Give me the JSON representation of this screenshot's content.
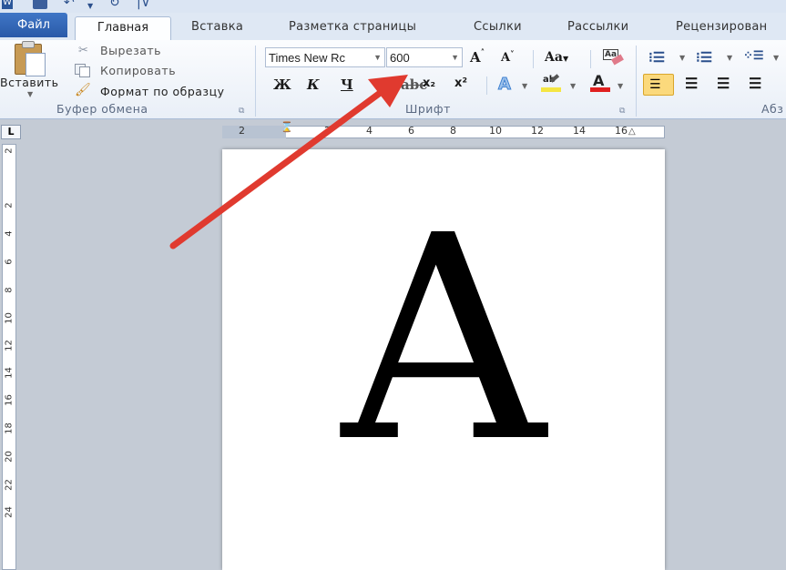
{
  "quick_access": {
    "word_icon": "word-app-icon",
    "save_icon": "save-icon",
    "undo_icon": "undo-icon",
    "redo_icon": "redo-icon",
    "customize_icon": "customize-qat-icon"
  },
  "tabs": {
    "file": "Файл",
    "home": "Главная",
    "insert": "Вставка",
    "layout": "Разметка страницы",
    "references": "Ссылки",
    "mailings": "Рассылки",
    "review": "Рецензирован"
  },
  "clipboard": {
    "paste_label": "Вставить",
    "cut_label": "Вырезать",
    "copy_label": "Копировать",
    "format_painter_label": "Формат по образцу",
    "group_label": "Буфер обмена"
  },
  "font": {
    "font_name": "Times New Rc",
    "font_size": "600",
    "bold": "Ж",
    "italic": "К",
    "underline": "Ч",
    "subscript": "x₂",
    "superscript": "x²",
    "change_case": "Aa",
    "group_label": "Шрифт"
  },
  "paragraph": {
    "group_label": "Абз"
  },
  "ruler": {
    "marks": [
      "2",
      "2",
      "4",
      "6",
      "8",
      "10",
      "12",
      "14",
      "16"
    ],
    "corner": "L"
  },
  "vruler": {
    "marks": [
      "2",
      "2",
      "4",
      "6",
      "8",
      "10",
      "12",
      "14",
      "16",
      "18",
      "20",
      "22",
      "24"
    ]
  },
  "document": {
    "content": "A"
  },
  "colors": {
    "file_tab": "#2a5aa8",
    "arrow": "#e03a2f",
    "highlight": "#f5e642",
    "font_color": "#e02020"
  }
}
